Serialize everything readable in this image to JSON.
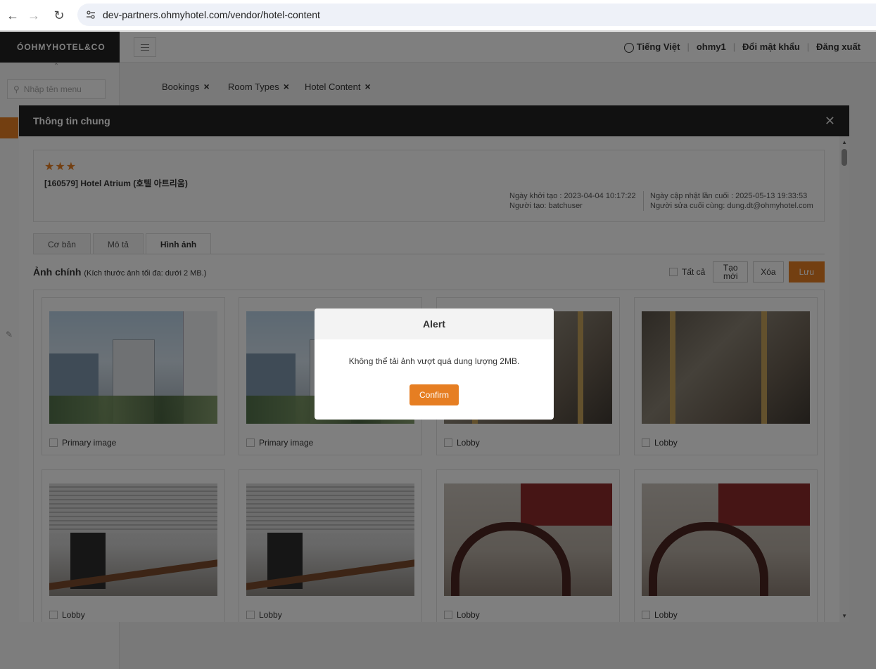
{
  "browser": {
    "url": "dev-partners.ohmyhotel.com/vendor/hotel-content"
  },
  "sidebar": {
    "logo": "ÓOHMYHOTEL&CO",
    "search_placeholder": "Nhập tên menu"
  },
  "header": {
    "language": "Tiếng Việt",
    "user": "ohmy1",
    "change_password": "Đổi mật khẩu",
    "logout": "Đăng xuất"
  },
  "open_tabs": [
    "Bookings",
    "Room Types",
    "Hotel Content"
  ],
  "modal": {
    "title": "Thông tin chung",
    "stars": "★★★",
    "hotel_name": "[160579] Hotel Atrium (호텔 아트리움)",
    "created_at": "Ngày khởi tạo : 2023-04-04 10:17:22",
    "created_by": "Người tạo: batchuser",
    "updated_at": "Ngày cập nhật lần cuối : 2025-05-13 19:33:53",
    "updated_by": "Người sửa cuối cùng: dung.dt@ohmyhotel.com",
    "tabs": [
      "Cơ bản",
      "Mô tả",
      "Hình ảnh"
    ],
    "section_title": "Ảnh chính",
    "section_hint": "(Kích thước ảnh tối đa: dưới 2 MB.)",
    "select_all": "Tất cả",
    "btn_new": "Tạo mới",
    "btn_delete": "Xóa",
    "btn_save": "Lưu",
    "images": [
      {
        "label": "Primary image",
        "kind": "building"
      },
      {
        "label": "Primary image",
        "kind": "building"
      },
      {
        "label": "Lobby",
        "kind": "lobby"
      },
      {
        "label": "Lobby",
        "kind": "lobby"
      },
      {
        "label": "Lobby",
        "kind": "office"
      },
      {
        "label": "Lobby",
        "kind": "office"
      },
      {
        "label": "Lobby",
        "kind": "chair"
      },
      {
        "label": "Lobby",
        "kind": "chair"
      }
    ]
  },
  "alert": {
    "title": "Alert",
    "message": "Không thể tải ảnh vượt quá dung lượng 2MB.",
    "confirm": "Confirm"
  },
  "colors": {
    "accent": "#e67e22",
    "dark_header": "#222222"
  }
}
